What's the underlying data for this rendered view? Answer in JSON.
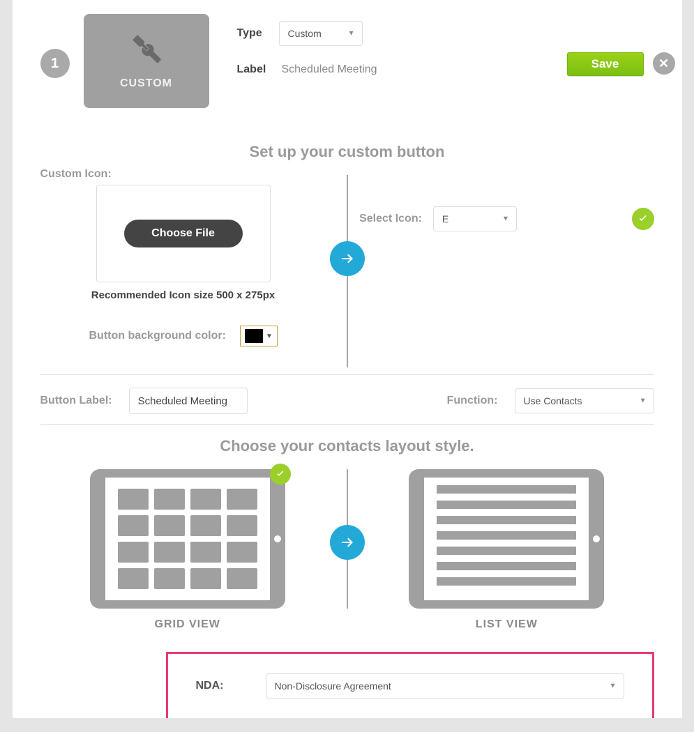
{
  "step": "1",
  "preview": {
    "label": "CUSTOM"
  },
  "top": {
    "type_label": "Type",
    "type_value": "Custom",
    "label_label": "Label",
    "label_value": "Scheduled Meeting",
    "save": "Save"
  },
  "setup": {
    "title": "Set up your custom button",
    "custom_icon_label": "Custom Icon:",
    "choose_file": "Choose File",
    "recommendation": "Recommended Icon size 500 x 275px",
    "bg_label": "Button background color:",
    "select_icon_label": "Select Icon:",
    "select_icon_value": "E"
  },
  "label_func": {
    "label_title": "Button Label:",
    "label_value": "Scheduled Meeting",
    "function_title": "Function:",
    "function_value": "Use Contacts"
  },
  "layout": {
    "title": "Choose your contacts layout style.",
    "grid": "GRID VIEW",
    "list": "LIST VIEW"
  },
  "nda": {
    "label": "NDA:",
    "value": "Non-Disclosure Agreement"
  }
}
